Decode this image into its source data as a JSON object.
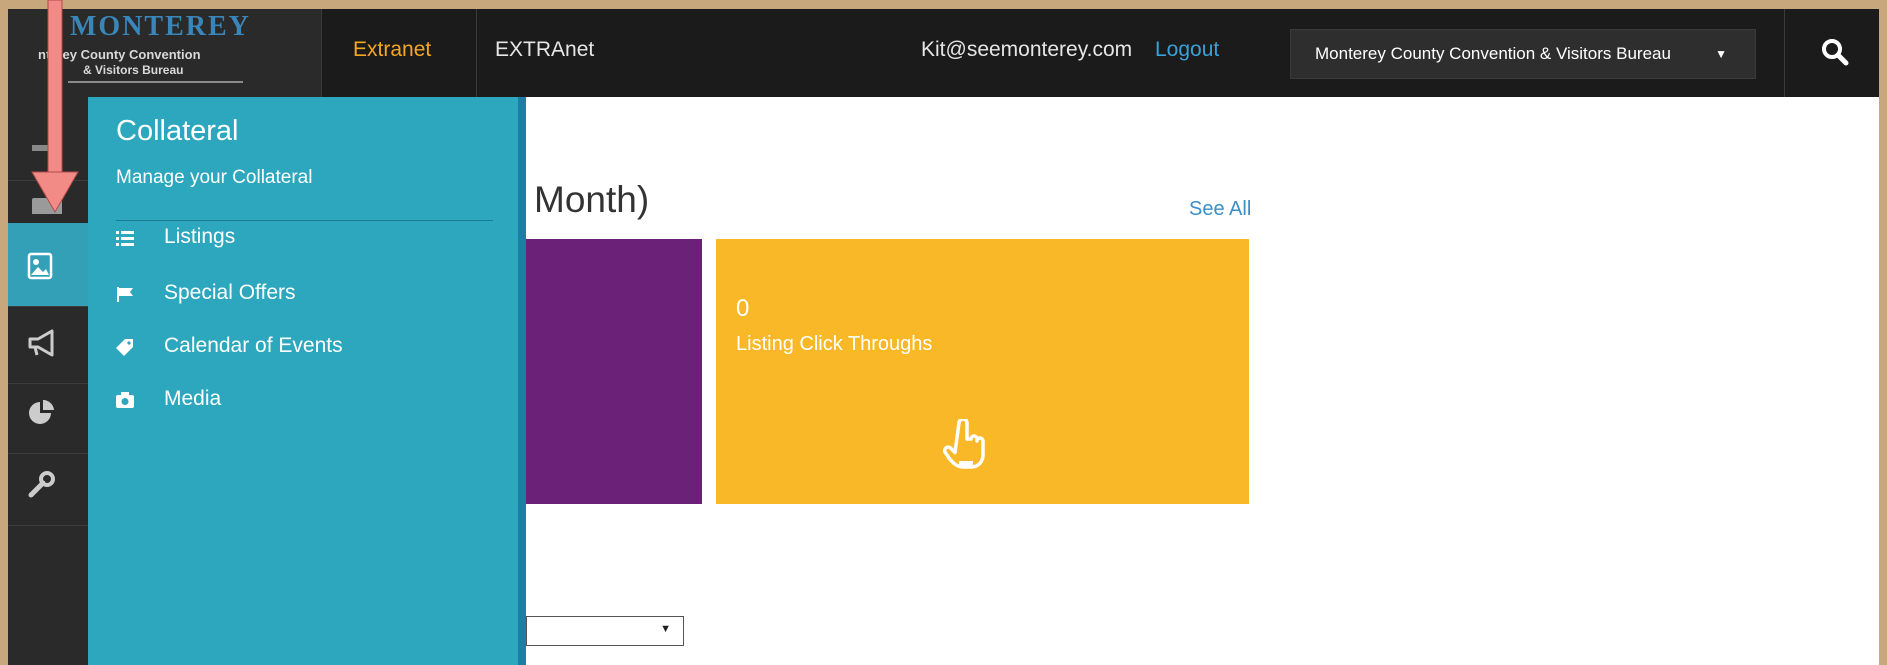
{
  "header": {
    "logo": {
      "word": "MONTEREY",
      "line1": "nterey County Convention",
      "line2": "& Visitors Bureau"
    },
    "tab_extranet": "Extranet",
    "tab_extranet_alt": "EXTRAnet",
    "user_email": "Kit@seemonterey.com",
    "logout_label": "Logout",
    "org_select_value": "Monterey County Convention & Visitors Bureau",
    "search_icon": "search-icon"
  },
  "rail": {
    "items": [
      {
        "icon": "partial-icon"
      },
      {
        "icon": "envelope-icon"
      },
      {
        "icon": "image-icon",
        "active": true
      },
      {
        "icon": "megaphone-icon"
      },
      {
        "icon": "pie-chart-icon"
      },
      {
        "icon": "wrench-icon"
      }
    ]
  },
  "flyout": {
    "title": "Collateral",
    "subtitle": "Manage your Collateral",
    "items": [
      {
        "label": "Listings",
        "icon": "list-icon"
      },
      {
        "label": "Special Offers",
        "icon": "flag-icon"
      },
      {
        "label": "Calendar of Events",
        "icon": "tag-icon"
      },
      {
        "label": "Media",
        "icon": "camera-icon"
      }
    ]
  },
  "main": {
    "section_heading": "Month)",
    "see_all": "See All",
    "tile": {
      "value": "0",
      "label": "Listing Click Throughs"
    }
  },
  "colors": {
    "accent": "#2da7bd",
    "purple_tile": "#6b2178",
    "yellow_tile": "#f9b827",
    "orange_tab": "#f5a623",
    "annotation_arrow": "#f28b86"
  }
}
